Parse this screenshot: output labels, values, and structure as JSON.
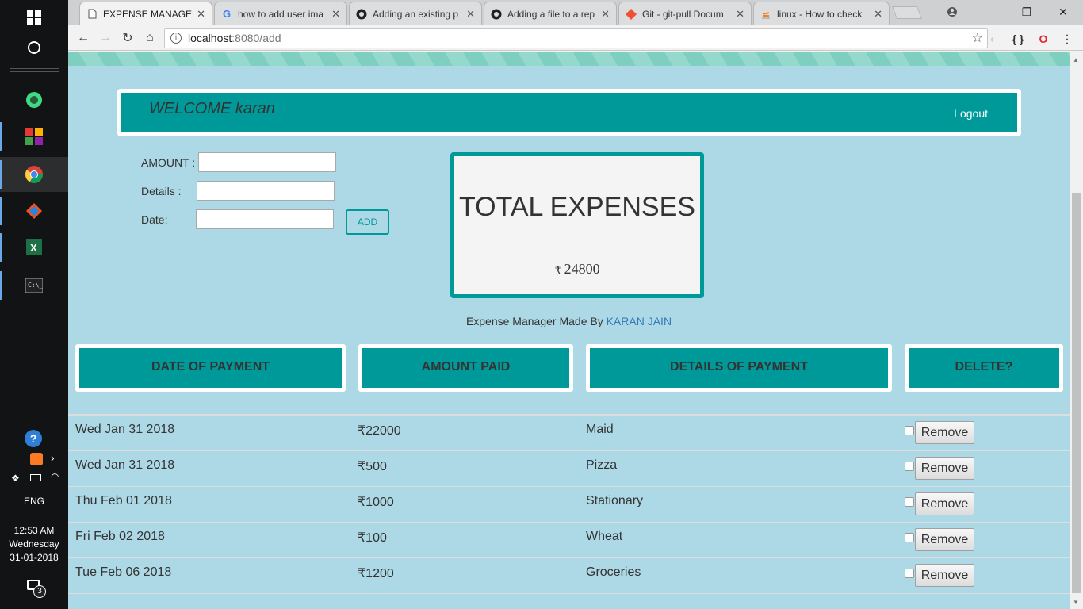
{
  "taskbar": {
    "tray": {
      "language": "ENG",
      "time": "12:53 AM",
      "day": "Wednesday",
      "date": "31-01-2018",
      "notification_count": "3"
    }
  },
  "browser": {
    "tabs": [
      {
        "title": "EXPENSE MANAGER",
        "icon": "document-icon",
        "active": true
      },
      {
        "title": "how to add user ima",
        "icon": "google-icon",
        "active": false
      },
      {
        "title": "Adding an existing p",
        "icon": "github-icon",
        "active": false
      },
      {
        "title": "Adding a file to a rep",
        "icon": "github-icon",
        "active": false
      },
      {
        "title": "Git - git-pull Docum",
        "icon": "git-icon",
        "active": false
      },
      {
        "title": "linux - How to check",
        "icon": "stackoverflow-icon",
        "active": false
      }
    ],
    "url_host": "localhost",
    "url_path": ":8080/add"
  },
  "page": {
    "welcome": "WELCOME karan",
    "logout": "Logout",
    "form": {
      "amount_label": "AMOUNT :",
      "details_label": "Details :",
      "date_label": "Date:",
      "add_button": "ADD"
    },
    "total": {
      "title": "TOTAL EXPENSES",
      "currency": "₹",
      "amount": "24800"
    },
    "credit": {
      "prefix": "Expense Manager Made By",
      "author": "KARAN JAIN"
    },
    "table": {
      "headers": [
        "DATE OF PAYMENT",
        "AMOUNT PAID",
        "DETAILS OF PAYMENT",
        "DELETE?"
      ],
      "remove_label": "Remove",
      "rows": [
        {
          "date": "Wed Jan 31 2018",
          "amount": "₹22000",
          "details": "Maid"
        },
        {
          "date": "Wed Jan 31 2018",
          "amount": "₹500",
          "details": "Pizza"
        },
        {
          "date": "Thu Feb 01 2018",
          "amount": "₹1000",
          "details": "Stationary"
        },
        {
          "date": "Fri Feb 02 2018",
          "amount": "₹100",
          "details": "Wheat"
        },
        {
          "date": "Tue Feb 06 2018",
          "amount": "₹1200",
          "details": "Groceries"
        }
      ]
    }
  },
  "colors": {
    "page_background": "#add8e6",
    "accent_teal": "#009999",
    "link_blue": "#337ab7"
  }
}
